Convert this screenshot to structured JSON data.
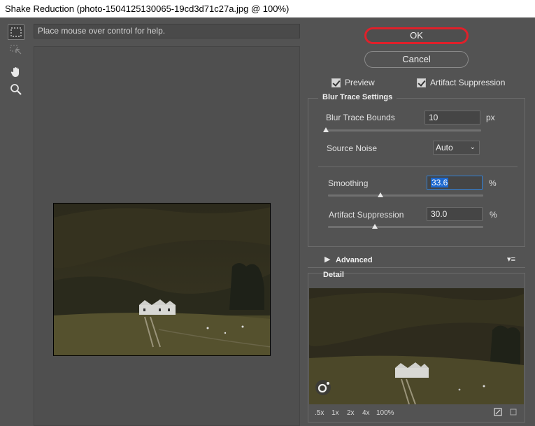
{
  "window": {
    "title": "Shake Reduction (photo-1504125130065-19cd3d71c27a.jpg @ 100%)"
  },
  "toolbar": {
    "tools": [
      "marquee-icon",
      "blur-estimation-icon",
      "hand-icon",
      "zoom-icon"
    ]
  },
  "help": {
    "text": "Place mouse over control for help."
  },
  "buttons": {
    "ok": "OK",
    "cancel": "Cancel"
  },
  "options": {
    "preview": "Preview",
    "artifact_suppression": "Artifact Suppression",
    "preview_checked": true,
    "artifact_checked": true
  },
  "blur_trace": {
    "title": "Blur Trace Settings",
    "bounds_label": "Blur Trace Bounds",
    "bounds_value": "10",
    "bounds_unit": "px",
    "bounds_slider": 0.0,
    "noise_label": "Source Noise",
    "noise_value": "Auto",
    "smoothing_label": "Smoothing",
    "smoothing_value": "33.6",
    "smoothing_unit": "%",
    "smoothing_slider": 0.34,
    "artifact_label": "Artifact Suppression",
    "artifact_value": "30.0",
    "artifact_unit": "%",
    "artifact_slider": 0.3
  },
  "advanced": {
    "label": "Advanced"
  },
  "detail": {
    "title": "Detail",
    "zoom_levels": [
      ".5x",
      "1x",
      "2x",
      "4x",
      "100%"
    ]
  },
  "colors": {
    "ok_highlight": "#e0202a",
    "focus": "#2e7fd8",
    "selection": "#1c68d0"
  }
}
